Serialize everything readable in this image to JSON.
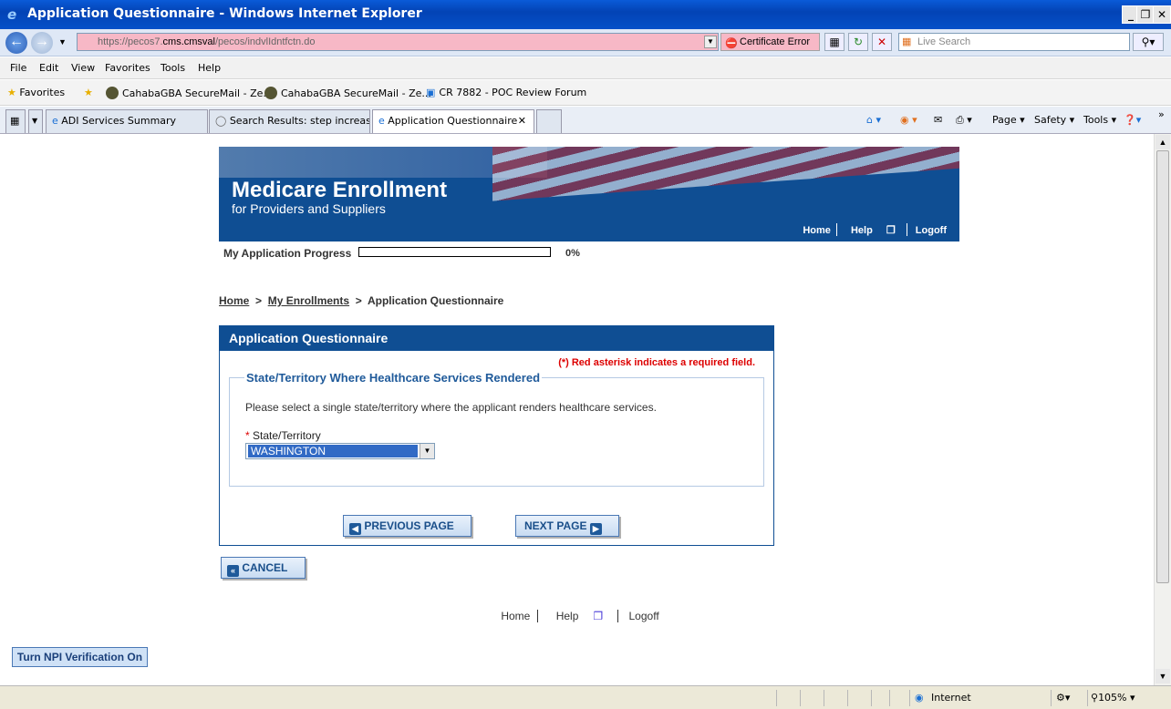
{
  "window": {
    "title": "Application Questionnaire - Windows Internet Explorer"
  },
  "address": {
    "url_prefix": "https://pecos7.",
    "url_host": "cms.cmsval",
    "url_path": "/pecos/indvlIdntfctn.do",
    "cert_error": "Certificate Error",
    "search_placeholder": "Live Search"
  },
  "menu": [
    "File",
    "Edit",
    "View",
    "Favorites",
    "Tools",
    "Help"
  ],
  "favorites": {
    "label": "Favorites",
    "items": [
      "CahabaGBA SecureMail - Ze...",
      "CahabaGBA SecureMail - Ze...",
      "CR 7882 - POC Review Forum"
    ]
  },
  "tabs": [
    "ADI Services Summary",
    "Search Results: step increas...",
    "Application Questionnaire"
  ],
  "commandbar": {
    "page": "Page",
    "safety": "Safety",
    "tools": "Tools"
  },
  "banner": {
    "title": "Medicare Enrollment",
    "subtitle": "for Providers and Suppliers",
    "links": {
      "home": "Home",
      "help": "Help",
      "logoff": "Logoff"
    }
  },
  "progress": {
    "label": "My Application Progress",
    "percent_text": "0%",
    "fraction": 0
  },
  "breadcrumb": {
    "home": "Home",
    "enrollments": "My Enrollments",
    "current": "Application Questionnaire",
    "separator": ">"
  },
  "panel": {
    "title": "Application Questionnaire",
    "required_note": "(*) Red asterisk indicates a required field.",
    "section_title": "State/Territory Where Healthcare Services Rendered",
    "instructions": "Please select a single state/territory where the applicant renders healthcare services.",
    "field_label": "State/Territory",
    "field_required_mark": "*",
    "selected_state": "WASHINGTON",
    "prev_label": "PREVIOUS PAGE",
    "next_label": "NEXT PAGE"
  },
  "cancel_label": "CANCEL",
  "footer": {
    "home": "Home",
    "help": "Help",
    "logoff": "Logoff"
  },
  "npi_button": "Turn NPI Verification On",
  "status": {
    "zone": "Internet",
    "zoom": "105%"
  }
}
